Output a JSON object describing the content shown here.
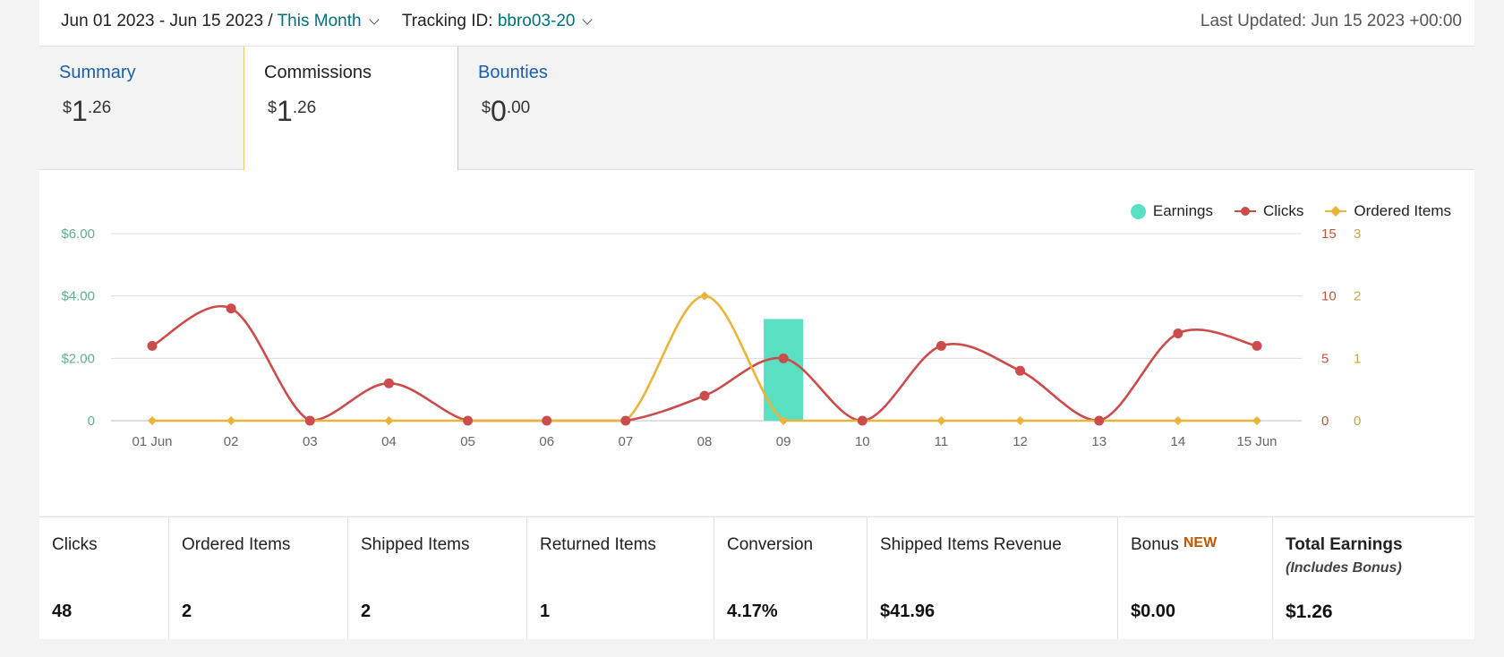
{
  "topbar": {
    "date_range": "Jun 01 2023 - Jun 15 2023",
    "separator": "/",
    "period": "This Month",
    "tracking_label": "Tracking ID:",
    "tracking_id": "bbro03-20",
    "last_updated": "Last Updated: Jun 15 2023 +00:00"
  },
  "tabs": [
    {
      "label": "Summary",
      "currency": "$",
      "whole": "1",
      "cents": ".26"
    },
    {
      "label": "Commissions",
      "currency": "$",
      "whole": "1",
      "cents": ".26"
    },
    {
      "label": "Bounties",
      "currency": "$",
      "whole": "0",
      "cents": ".00"
    }
  ],
  "legend": {
    "earnings": "Earnings",
    "clicks": "Clicks",
    "ordered": "Ordered Items"
  },
  "colors": {
    "earnings": "#59e0c2",
    "clicks": "#cc4b4b",
    "ordered": "#eab43a",
    "link": "#1a5fa8",
    "teal": "#00707a",
    "axis_left": "#5fae8e",
    "axis_right_clicks": "#c0533f",
    "axis_right_ordered": "#c9a24a"
  },
  "chart_data": {
    "type": "bar",
    "categories": [
      "01 Jun",
      "02",
      "03",
      "04",
      "05",
      "06",
      "07",
      "08",
      "09",
      "10",
      "11",
      "12",
      "13",
      "14",
      "15 Jun"
    ],
    "series": [
      {
        "name": "Earnings",
        "type": "bar",
        "axis": "earnings",
        "values": [
          0,
          0,
          0,
          0,
          0,
          0,
          0,
          0,
          3.26,
          0,
          0,
          0,
          0,
          0,
          0
        ]
      },
      {
        "name": "Clicks",
        "type": "line",
        "axis": "clicks",
        "values": [
          6,
          9,
          0,
          3,
          0,
          0,
          0,
          2,
          5,
          0,
          6,
          4,
          0,
          7,
          6
        ]
      },
      {
        "name": "Ordered Items",
        "type": "line",
        "axis": "ordered",
        "values": [
          0,
          0,
          0,
          0,
          0,
          0,
          0,
          2,
          0,
          0,
          0,
          0,
          0,
          0,
          0
        ]
      }
    ],
    "axes": {
      "earnings": {
        "range": [
          0,
          6
        ],
        "ticks": [
          "0",
          "$2.00",
          "$4.00",
          "$6.00"
        ]
      },
      "clicks": {
        "range": [
          0,
          15
        ],
        "ticks": [
          "0",
          "5",
          "10",
          "15"
        ]
      },
      "ordered": {
        "range": [
          0,
          3
        ],
        "ticks": [
          "0",
          "1",
          "2",
          "3"
        ]
      }
    },
    "grid": true,
    "legend_position": "top-right"
  },
  "stats": [
    {
      "label": "Clicks",
      "value": "48"
    },
    {
      "label": "Ordered Items",
      "value": "2"
    },
    {
      "label": "Shipped Items",
      "value": "2"
    },
    {
      "label": "Returned Items",
      "value": "1"
    },
    {
      "label": "Conversion",
      "value": "4.17%"
    },
    {
      "label": "Shipped Items Revenue",
      "value": "$41.96"
    },
    {
      "label": "Bonus",
      "badge": "NEW",
      "value": "$0.00"
    },
    {
      "label": "Total Earnings",
      "sub": "(Includes Bonus)",
      "value": "$1.26"
    }
  ]
}
